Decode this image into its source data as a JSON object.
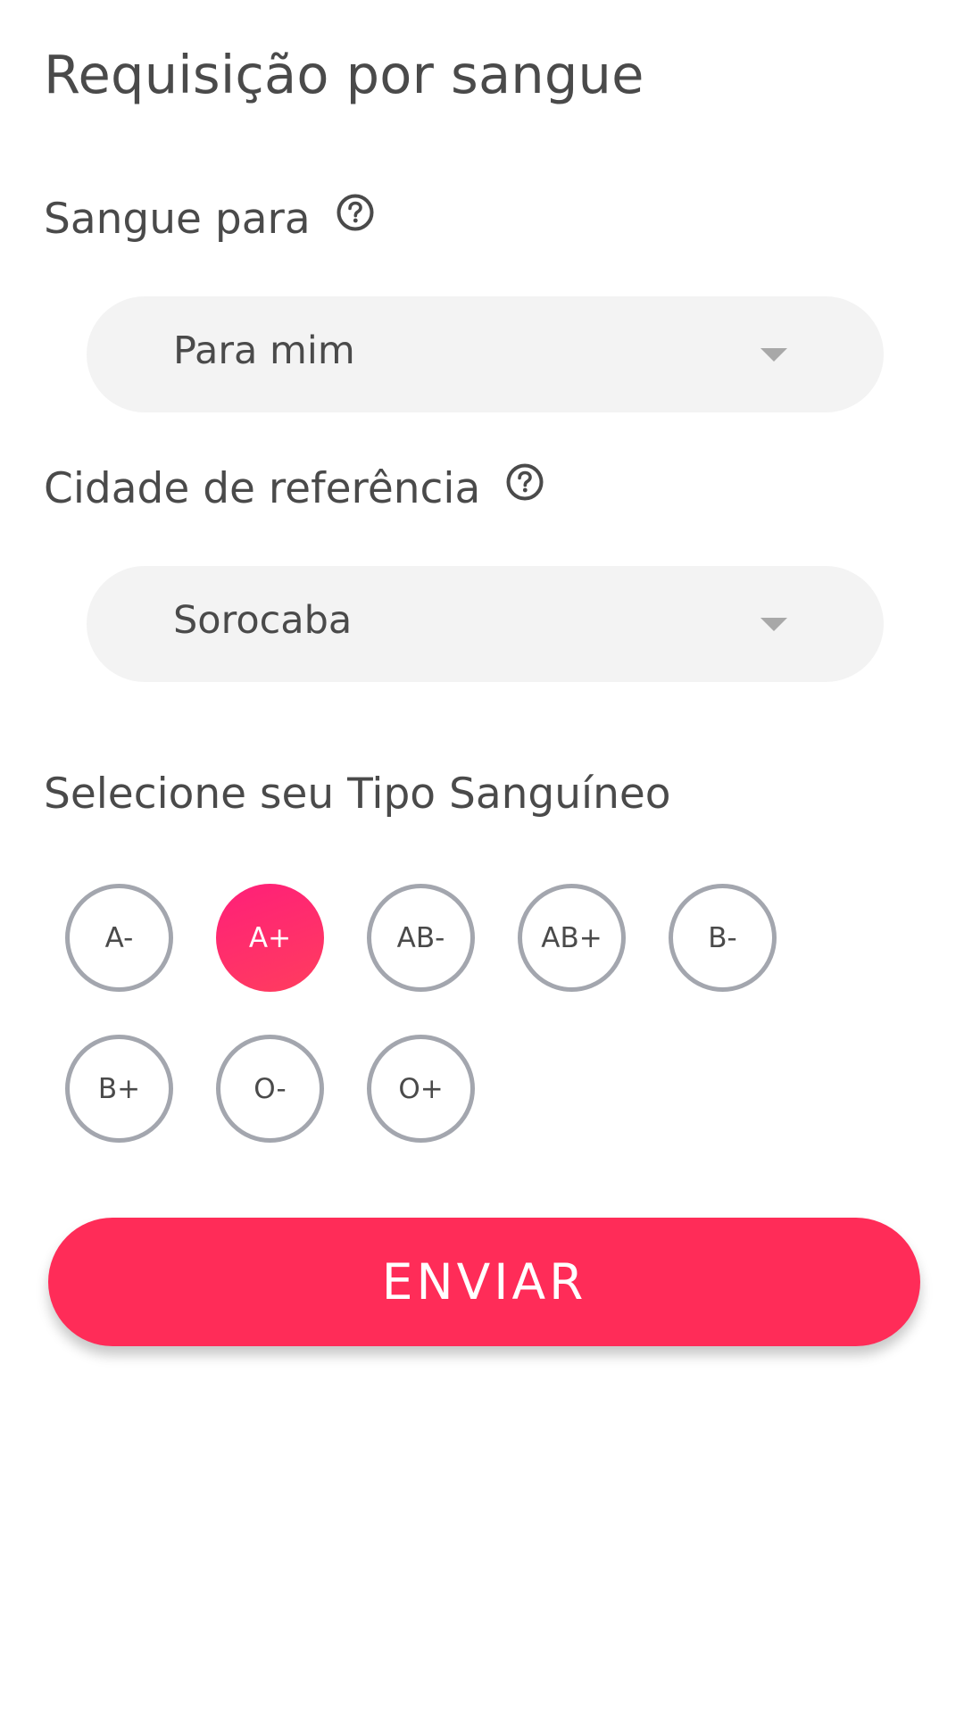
{
  "page": {
    "title": "Requisição por sangue"
  },
  "blood_for": {
    "label": "Sangue para",
    "help_icon": "question-circle-icon",
    "value": "Para mim"
  },
  "city": {
    "label": "Cidade de referência",
    "help_icon": "question-circle-icon",
    "value": "Sorocaba"
  },
  "blood_type": {
    "label": "Selecione seu Tipo Sanguíneo",
    "options": [
      "A-",
      "A+",
      "AB-",
      "AB+",
      "B-",
      "B+",
      "O-",
      "O+"
    ],
    "selected": "A+"
  },
  "submit": {
    "label": "ENVIAR"
  },
  "colors": {
    "accent": "#ff2c58",
    "selected_gradient_start": "#ff1f79",
    "selected_gradient_end": "#ff3d5e",
    "dropdown_bg": "#f3f3f3",
    "option_border": "#a3a6ae",
    "text": "#4a4a4a"
  }
}
